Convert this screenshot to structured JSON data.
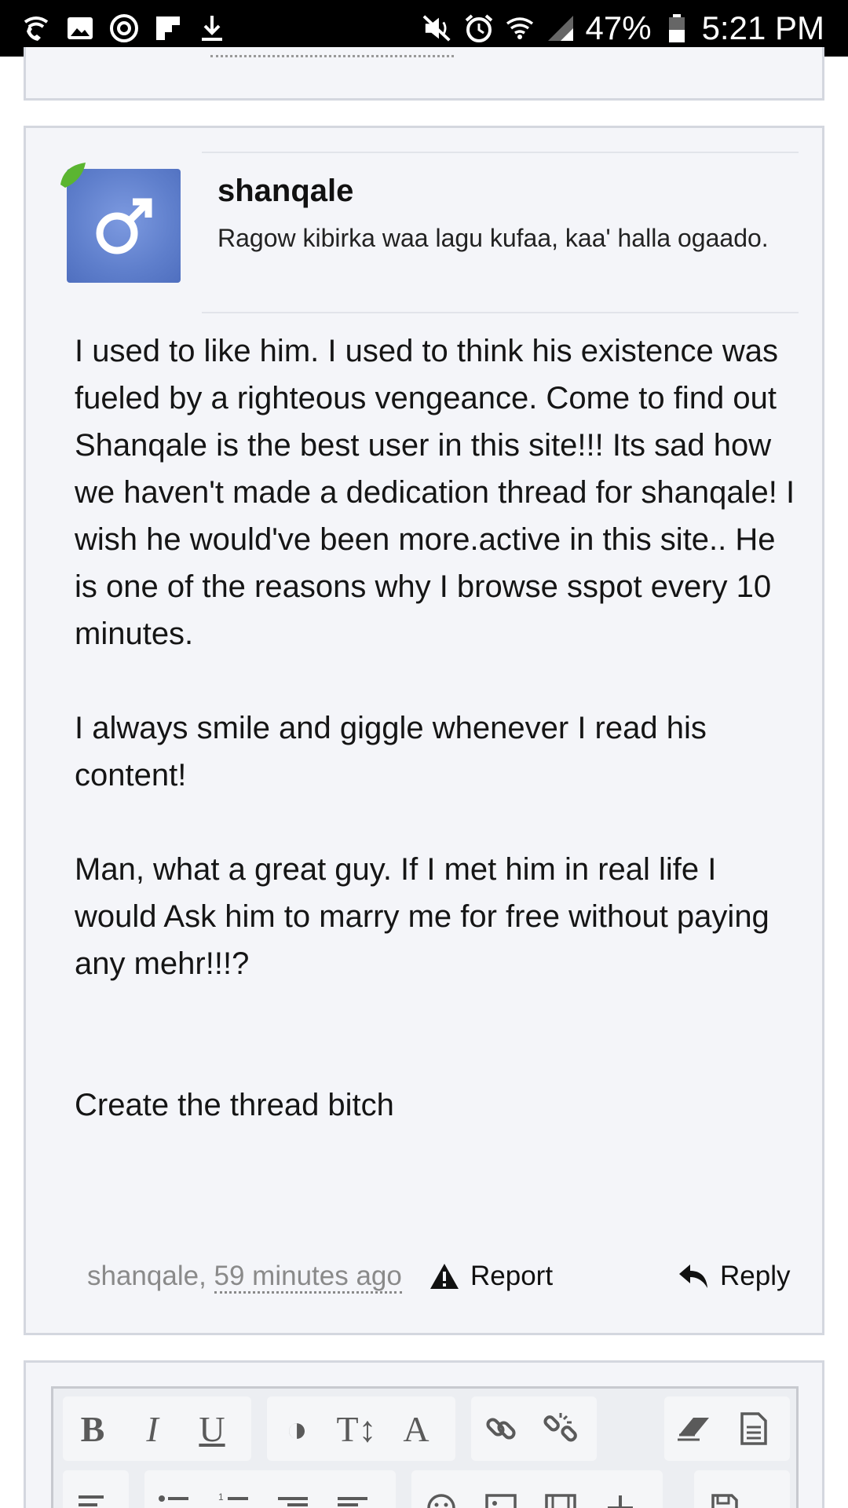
{
  "status_bar": {
    "battery": "47%",
    "time": "5:21 PM",
    "left_icons": [
      "wifi-call-icon",
      "gallery-icon",
      "sync-icon",
      "flipboard-icon",
      "download-icon"
    ],
    "right_icons": [
      "mute-icon",
      "alarm-icon",
      "wifi-icon",
      "signal-icon",
      "battery-icon"
    ]
  },
  "post": {
    "username": "shanqale",
    "user_title": "Ragow kibirka waa lagu kufaa, kaa' halla ogaado.",
    "avatar_symbol": "♂",
    "avatar_color": "#6a88d3",
    "online_color": "#5bb531",
    "paragraphs": [
      "I used to like him. I used to think his existence was fueled by a righteous vengeance. Come to find out Shanqale is the best user in this site!!! Its sad how we haven't made a dedication thread for shanqale! I wish he would've been more.active in this site.. He is one of the reasons why I browse sspot every 10 minutes.",
      "I always smile and giggle whenever I read his content!",
      "Man, what a great guy. If I met him in real life I would Ask him to marry me for free without paying any mehr!!!?",
      "Create the thread bitch"
    ],
    "footer": {
      "author": "shanqale,",
      "time_ago": "59 minutes ago",
      "report_label": "Report",
      "reply_label": "Reply"
    }
  },
  "editor": {
    "toolbar_row1": [
      "B",
      "I",
      "U",
      "◑",
      "T↕",
      "A",
      "link-icon",
      "unlink-icon",
      "eraser-icon",
      "template-icon"
    ],
    "toolbar_row2": [
      "align-icon",
      "bullet-list-icon",
      "number-list-icon",
      "outdent-icon",
      "indent-icon",
      "smilie-icon",
      "image-icon",
      "media-icon",
      "insert-icon",
      "save-icon"
    ]
  }
}
